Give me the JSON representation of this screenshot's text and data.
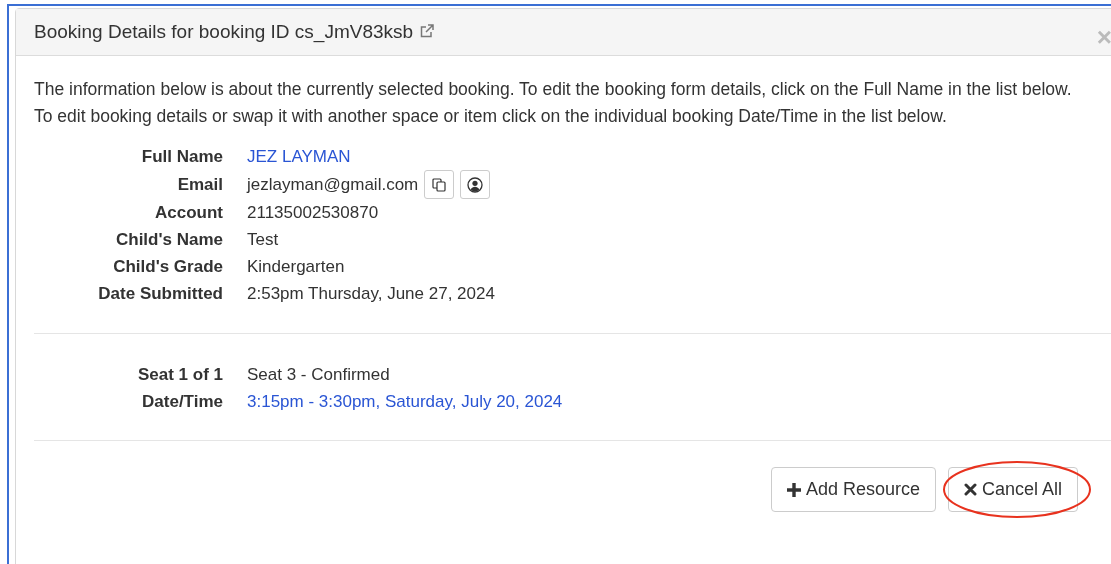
{
  "modal": {
    "title": "Booking Details for booking ID cs_JmV83ksb",
    "close": "×"
  },
  "intro": "The information below is about the currently selected booking. To edit the booking form details, click on the Full Name in the list below. To edit booking details or swap it with another space or item click on the individual booking Date/Time in the list below.",
  "details": [
    {
      "label": "Full Name",
      "value": "JEZ LAYMAN",
      "kind": "link"
    },
    {
      "label": "Email",
      "value": "jezlayman@gmail.com",
      "kind": "email"
    },
    {
      "label": "Account",
      "value": "21135002530870",
      "kind": "text"
    },
    {
      "label": "Child's Name",
      "value": "Test",
      "kind": "text"
    },
    {
      "label": "Child's Grade",
      "value": "Kindergarten",
      "kind": "text"
    },
    {
      "label": "Date Submitted",
      "value": "2:53pm Thursday, June 27, 2024",
      "kind": "text"
    }
  ],
  "seats": [
    {
      "label": "Seat 1 of 1",
      "value": "Seat 3 - Confirmed",
      "kind": "text"
    },
    {
      "label": "Date/Time",
      "value": "3:15pm - 3:30pm, Saturday, July 20, 2024",
      "kind": "link"
    }
  ],
  "buttons": [
    {
      "label": "Add Resource",
      "kind": "add",
      "highlighted": false
    },
    {
      "label": "Cancel All",
      "kind": "cancel",
      "highlighted": true
    }
  ]
}
